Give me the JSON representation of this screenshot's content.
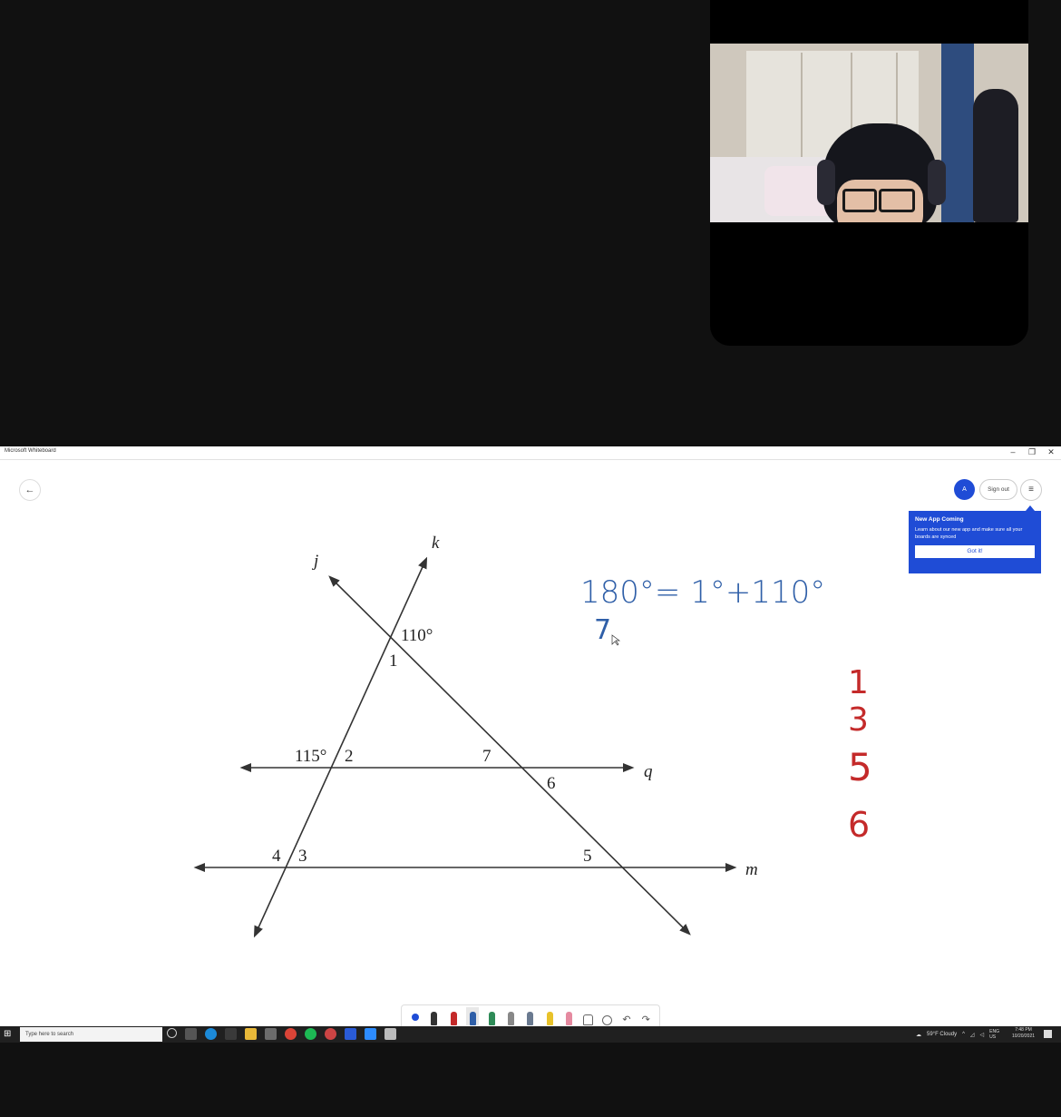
{
  "window": {
    "app_title": "Microsoft Whiteboard",
    "controls": {
      "minimize": "–",
      "restore": "❐",
      "close": "✕"
    }
  },
  "header": {
    "back_glyph": "←",
    "profile_glyph": "A",
    "signout_label": "Sign out",
    "menu_glyph": "≡"
  },
  "popup": {
    "title": "New App Coming",
    "body": "Learn about our new app and make sure all your boards are synced",
    "button_label": "Got it!"
  },
  "diagram": {
    "labels": {
      "line_j": "j",
      "line_k": "k",
      "line_q": "q",
      "line_m": "m",
      "angle_110": "110°",
      "angle_1": "1",
      "angle_115": "115°",
      "angle_2": "2",
      "angle_7": "7",
      "angle_6": "6",
      "angle_4": "4",
      "angle_3": "3",
      "angle_5": "5"
    }
  },
  "handwriting": {
    "blue_line1": "180°= 1°+110°",
    "blue_line2": "7",
    "red_list": [
      "1",
      "3",
      "5",
      "6"
    ],
    "blue_color": "#2f5fa8",
    "red_color": "#c42a2a"
  },
  "ink_toolbar": {
    "tools": [
      "select-dot",
      "pen-black",
      "pen-red",
      "pen-blue",
      "pen-green",
      "pen-gray",
      "pen-gray-2",
      "highlighter-yellow",
      "eraser",
      "lasso",
      "ruler",
      "undo",
      "redo"
    ],
    "undo_glyph": "↶",
    "redo_glyph": "↷"
  },
  "taskbar": {
    "start_glyph": "⊞",
    "search_placeholder": "Type here to search",
    "weather": "59°F Cloudy",
    "lang_top": "ENG",
    "lang_bottom": "US",
    "time": "7:48 PM",
    "date": "10/20/2021"
  }
}
